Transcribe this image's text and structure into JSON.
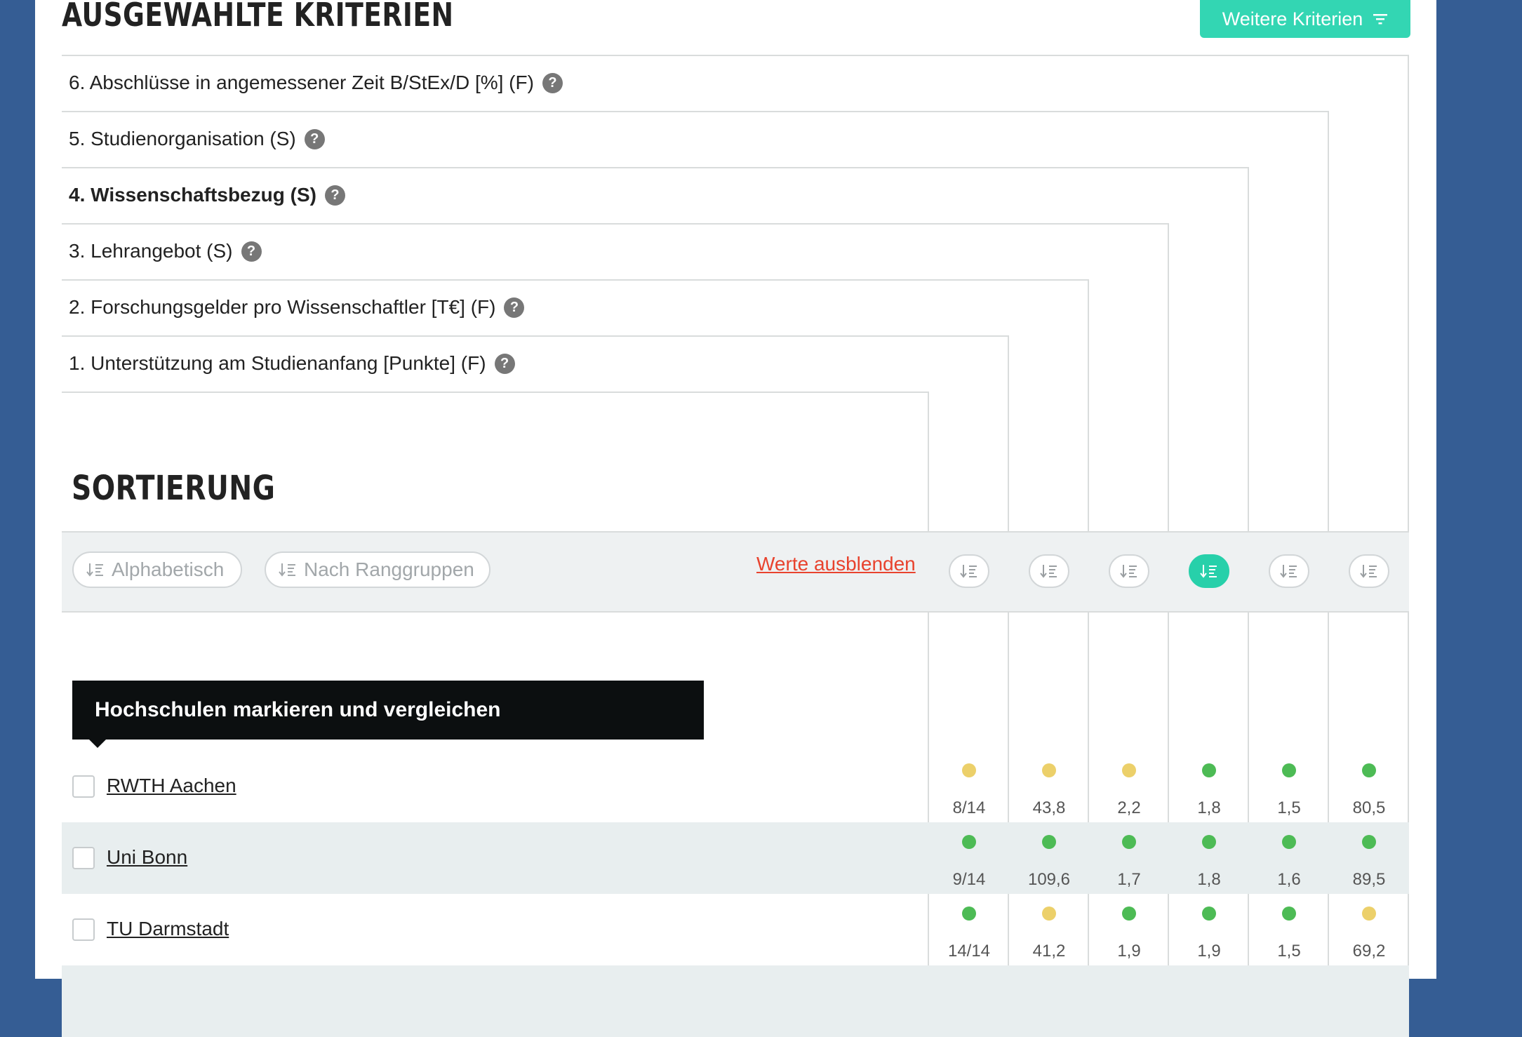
{
  "header": {
    "title": "AUSGEWÄHLTE KRITERIEN",
    "more_button": "Weitere Kriterien"
  },
  "criteria": [
    "6. Abschlüsse in angemessener Zeit B/StEx/D [%] (F)",
    "5. Studienorganisation (S)",
    "4. Wissenschaftsbezug (S)",
    "3. Lehrangebot (S)",
    "2. Forschungsgelder pro Wissenschaftler [T€] (F)",
    "1. Unterstützung am Studienanfang [Punkte] (F)"
  ],
  "help_icon": "?",
  "sort": {
    "title": "SORTIERUNG",
    "alphabetical": "Alphabetisch",
    "by_rank": "Nach Ranggruppen",
    "hide_values": "Werte ausblenden",
    "active_column": 4
  },
  "tooltip": "Hochschulen markieren und vergleichen",
  "colors": {
    "green": "#4dbb55",
    "yellow": "#ecd06a",
    "accent": "#33d6b3",
    "link": "#e8432e"
  },
  "universities": [
    {
      "name": "RWTH Aachen",
      "values": [
        "8/14",
        "43,8",
        "2,2",
        "1,8",
        "1,5",
        "80,5"
      ],
      "groups": [
        "yellow",
        "yellow",
        "yellow",
        "green",
        "green",
        "green"
      ]
    },
    {
      "name": "Uni Bonn",
      "values": [
        "9/14",
        "109,6",
        "1,7",
        "1,8",
        "1,6",
        "89,5"
      ],
      "groups": [
        "green",
        "green",
        "green",
        "green",
        "green",
        "green"
      ]
    },
    {
      "name": "TU Darmstadt",
      "values": [
        "14/14",
        "41,2",
        "1,9",
        "1,9",
        "1,5",
        "69,2"
      ],
      "groups": [
        "green",
        "yellow",
        "green",
        "green",
        "green",
        "yellow"
      ]
    }
  ]
}
